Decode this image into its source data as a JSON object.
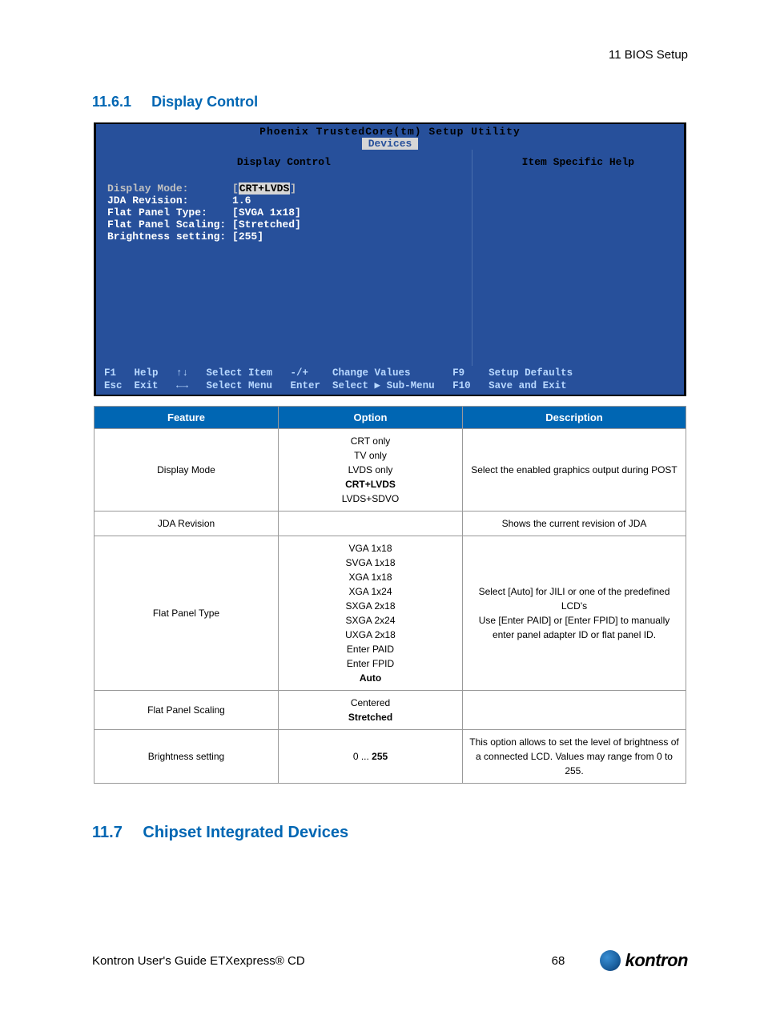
{
  "breadcrumb": "11 BIOS Setup",
  "section1": {
    "num": "11.6.1",
    "title": "Display Control"
  },
  "section2": {
    "num": "11.7",
    "title": "Chipset Integrated Devices"
  },
  "bios": {
    "title": "Phoenix TrustedCore(tm) Setup Utility",
    "tab": "Devices",
    "left_title": "Display Control",
    "right_title": "Item Specific Help",
    "rows": {
      "displayMode_label": "Display Mode:       ",
      "displayMode_open": "[",
      "displayMode_val": "CRT+LVDS",
      "displayMode_close": "]",
      "jda_label": "JDA Revision:       ",
      "jda_val": "1.6",
      "fpt_label": "Flat Panel Type:    ",
      "fpt_val": "[SVGA 1x18]",
      "fps_label": "Flat Panel Scaling: ",
      "fps_val": "[Stretched]",
      "bright_label": "Brightness setting: ",
      "bright_val": "[255]"
    },
    "footer": {
      "l1a": "F1   Help   ↑↓   Select Item   -/+    Change Values       F9    Setup Defaults",
      "l2a": "Esc  Exit   ←→   Select Menu   Enter  Select ▶ Sub-Menu   F10   Save and Exit"
    }
  },
  "table": {
    "headers": {
      "feature": "Feature",
      "option": "Option",
      "description": "Description"
    },
    "rows": [
      {
        "feature": "Display Mode",
        "options": [
          "CRT only",
          "TV only",
          "LVDS only",
          "CRT+LVDS",
          "LVDS+SDVO"
        ],
        "bold_idx": 3,
        "description": "Select the enabled graphics output during POST"
      },
      {
        "feature": "JDA Revision",
        "options": [],
        "bold_idx": -1,
        "description": "Shows the current revision of JDA"
      },
      {
        "feature": "Flat Panel Type",
        "options": [
          "VGA 1x18",
          "SVGA 1x18",
          "XGA 1x18",
          "XGA 1x24",
          "SXGA 2x18",
          "SXGA 2x24",
          "UXGA 2x18",
          "Enter PAID",
          "Enter FPID",
          "Auto"
        ],
        "bold_idx": 9,
        "description": "Select [Auto] for JILI or one of the predefined LCD's\nUse [Enter PAID] or [Enter FPID] to manually enter panel adapter ID or flat panel ID."
      },
      {
        "feature": "Flat Panel Scaling",
        "options": [
          "Centered",
          "Stretched"
        ],
        "bold_idx": 1,
        "description": ""
      },
      {
        "feature": "Brightness setting",
        "options_plain": "0 ... 255",
        "bold_idx": -2,
        "description": "This option allows to set the level of brightness of a connected LCD. Values may range from 0 to 255."
      }
    ]
  },
  "footer": {
    "left": "Kontron User's Guide ETXexpress® CD",
    "page": "68",
    "logo": "kontron"
  }
}
